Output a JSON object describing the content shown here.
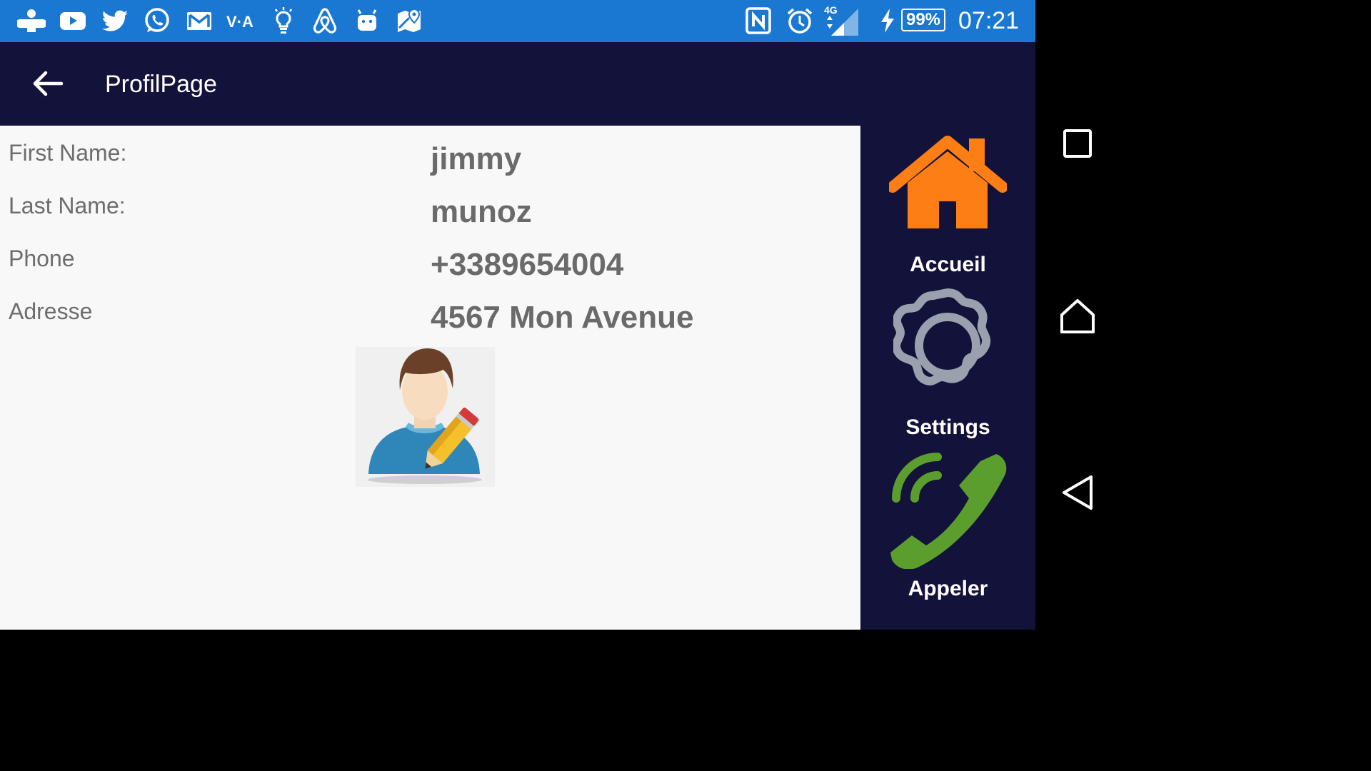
{
  "status_bar": {
    "battery": "99%",
    "time": "07:21",
    "network": "4G",
    "notification_icons": [
      "games-icon",
      "youtube-icon",
      "twitter-icon",
      "whatsapp-icon",
      "gmail-icon",
      "vla-icon",
      "lightbulb-icon",
      "airbnb-icon",
      "android-icon",
      "maps-icon"
    ],
    "system_icons": [
      "nfc-icon",
      "alarm-icon",
      "signal-icon",
      "charging-icon"
    ]
  },
  "app_bar": {
    "title": "ProfilPage"
  },
  "profile": {
    "first_name_label": "First Name:",
    "first_name": "jimmy",
    "last_name_label": "Last Name:",
    "last_name": "munoz",
    "phone_label": "Phone",
    "phone": "+3389654004",
    "address_label": "Adresse",
    "address": "4567 Mon Avenue"
  },
  "menu": {
    "home_label": "Accueil",
    "settings_label": "Settings",
    "call_label": "Appeler",
    "colors": {
      "home": "#fd7e14",
      "settings": "#9aa0ad",
      "call": "#5b9e2e"
    }
  },
  "colors": {
    "status_bar": "#1a78d2",
    "app_bar": "#13123b",
    "content_bg": "#f8f8f8"
  }
}
